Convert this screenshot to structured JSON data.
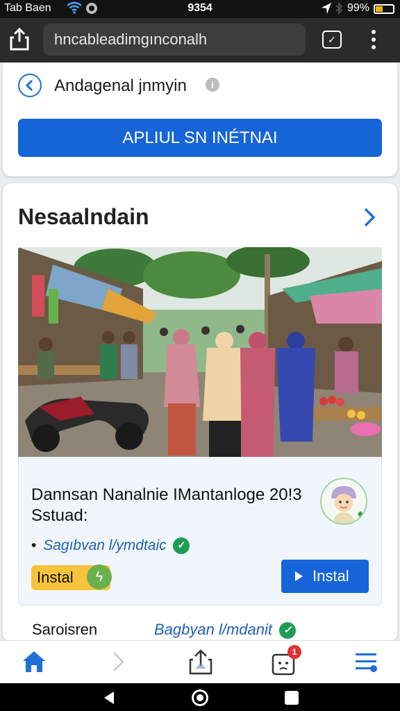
{
  "status_bar": {
    "carrier": "Tab Baen",
    "time": "9354",
    "battery": "99%"
  },
  "browser": {
    "url": "hncableadimgınconalh"
  },
  "top_card": {
    "title": "Andagenal jnmyin",
    "info_icon": "i",
    "apply_button": "APLIUL SN INÉTNAI"
  },
  "section": {
    "title": "Nesaalndain"
  },
  "app_card": {
    "title": "Dannsan Nanalnie IMantanloge 20!3 Sstuad:",
    "developer_bullet": "•",
    "developer": "Sagıbvan l/ymdtaic",
    "install_badge": "Instal",
    "install_button": "Instal"
  },
  "footer_row": {
    "label": "Saroisren",
    "developer": "Bagbyan l/mdanit"
  },
  "bottom_nav": {
    "tabs_badge": "1"
  },
  "colors": {
    "accent": "#1565d8",
    "verified": "#1f9d57",
    "badge": "#f7c33c",
    "notification": "#e0322d"
  },
  "icons": [
    "share-icon",
    "tabs-icon",
    "more-vert-icon",
    "back-circle-icon",
    "info-icon",
    "chevron-right-icon",
    "verified-check-icon",
    "bolt-icon",
    "play-icon",
    "home-icon",
    "forward-icon",
    "share-up-icon",
    "tab-switcher-icon",
    "menu-icon"
  ]
}
